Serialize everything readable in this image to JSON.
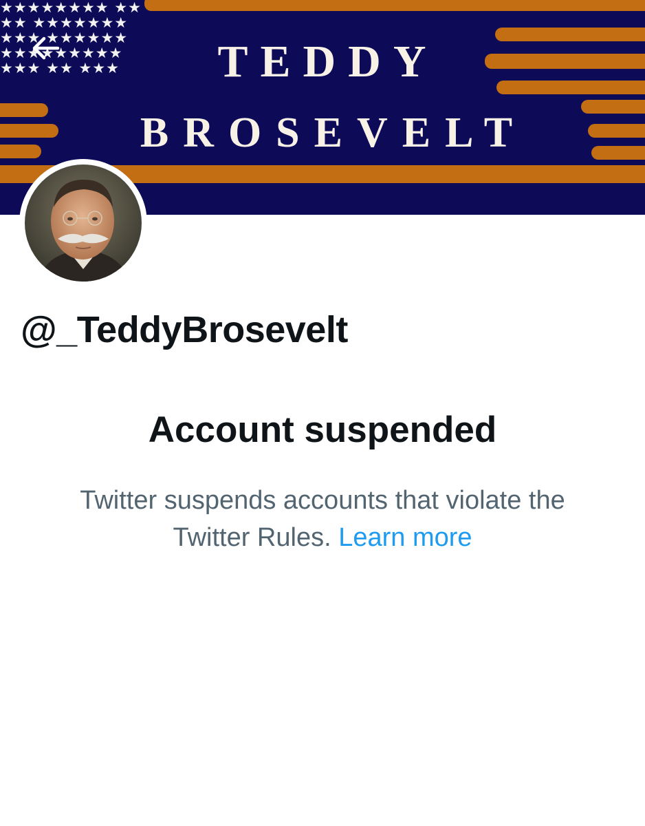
{
  "header": {
    "banner_line1": "Teddy",
    "banner_line2": "Brosevelt",
    "back_icon": "arrow-left-icon",
    "banner_colors": {
      "navy": "#0d0a57",
      "orange": "#c46e14",
      "cream": "#f7f1e6"
    }
  },
  "profile": {
    "avatar": "portrait-avatar",
    "handle": "@_TeddyBrosevelt"
  },
  "notice": {
    "title": "Account suspended",
    "message": "Twitter suspends accounts that violate the Twitter Rules.",
    "link_label": "Learn more",
    "link_color": "#1d9bf0"
  }
}
